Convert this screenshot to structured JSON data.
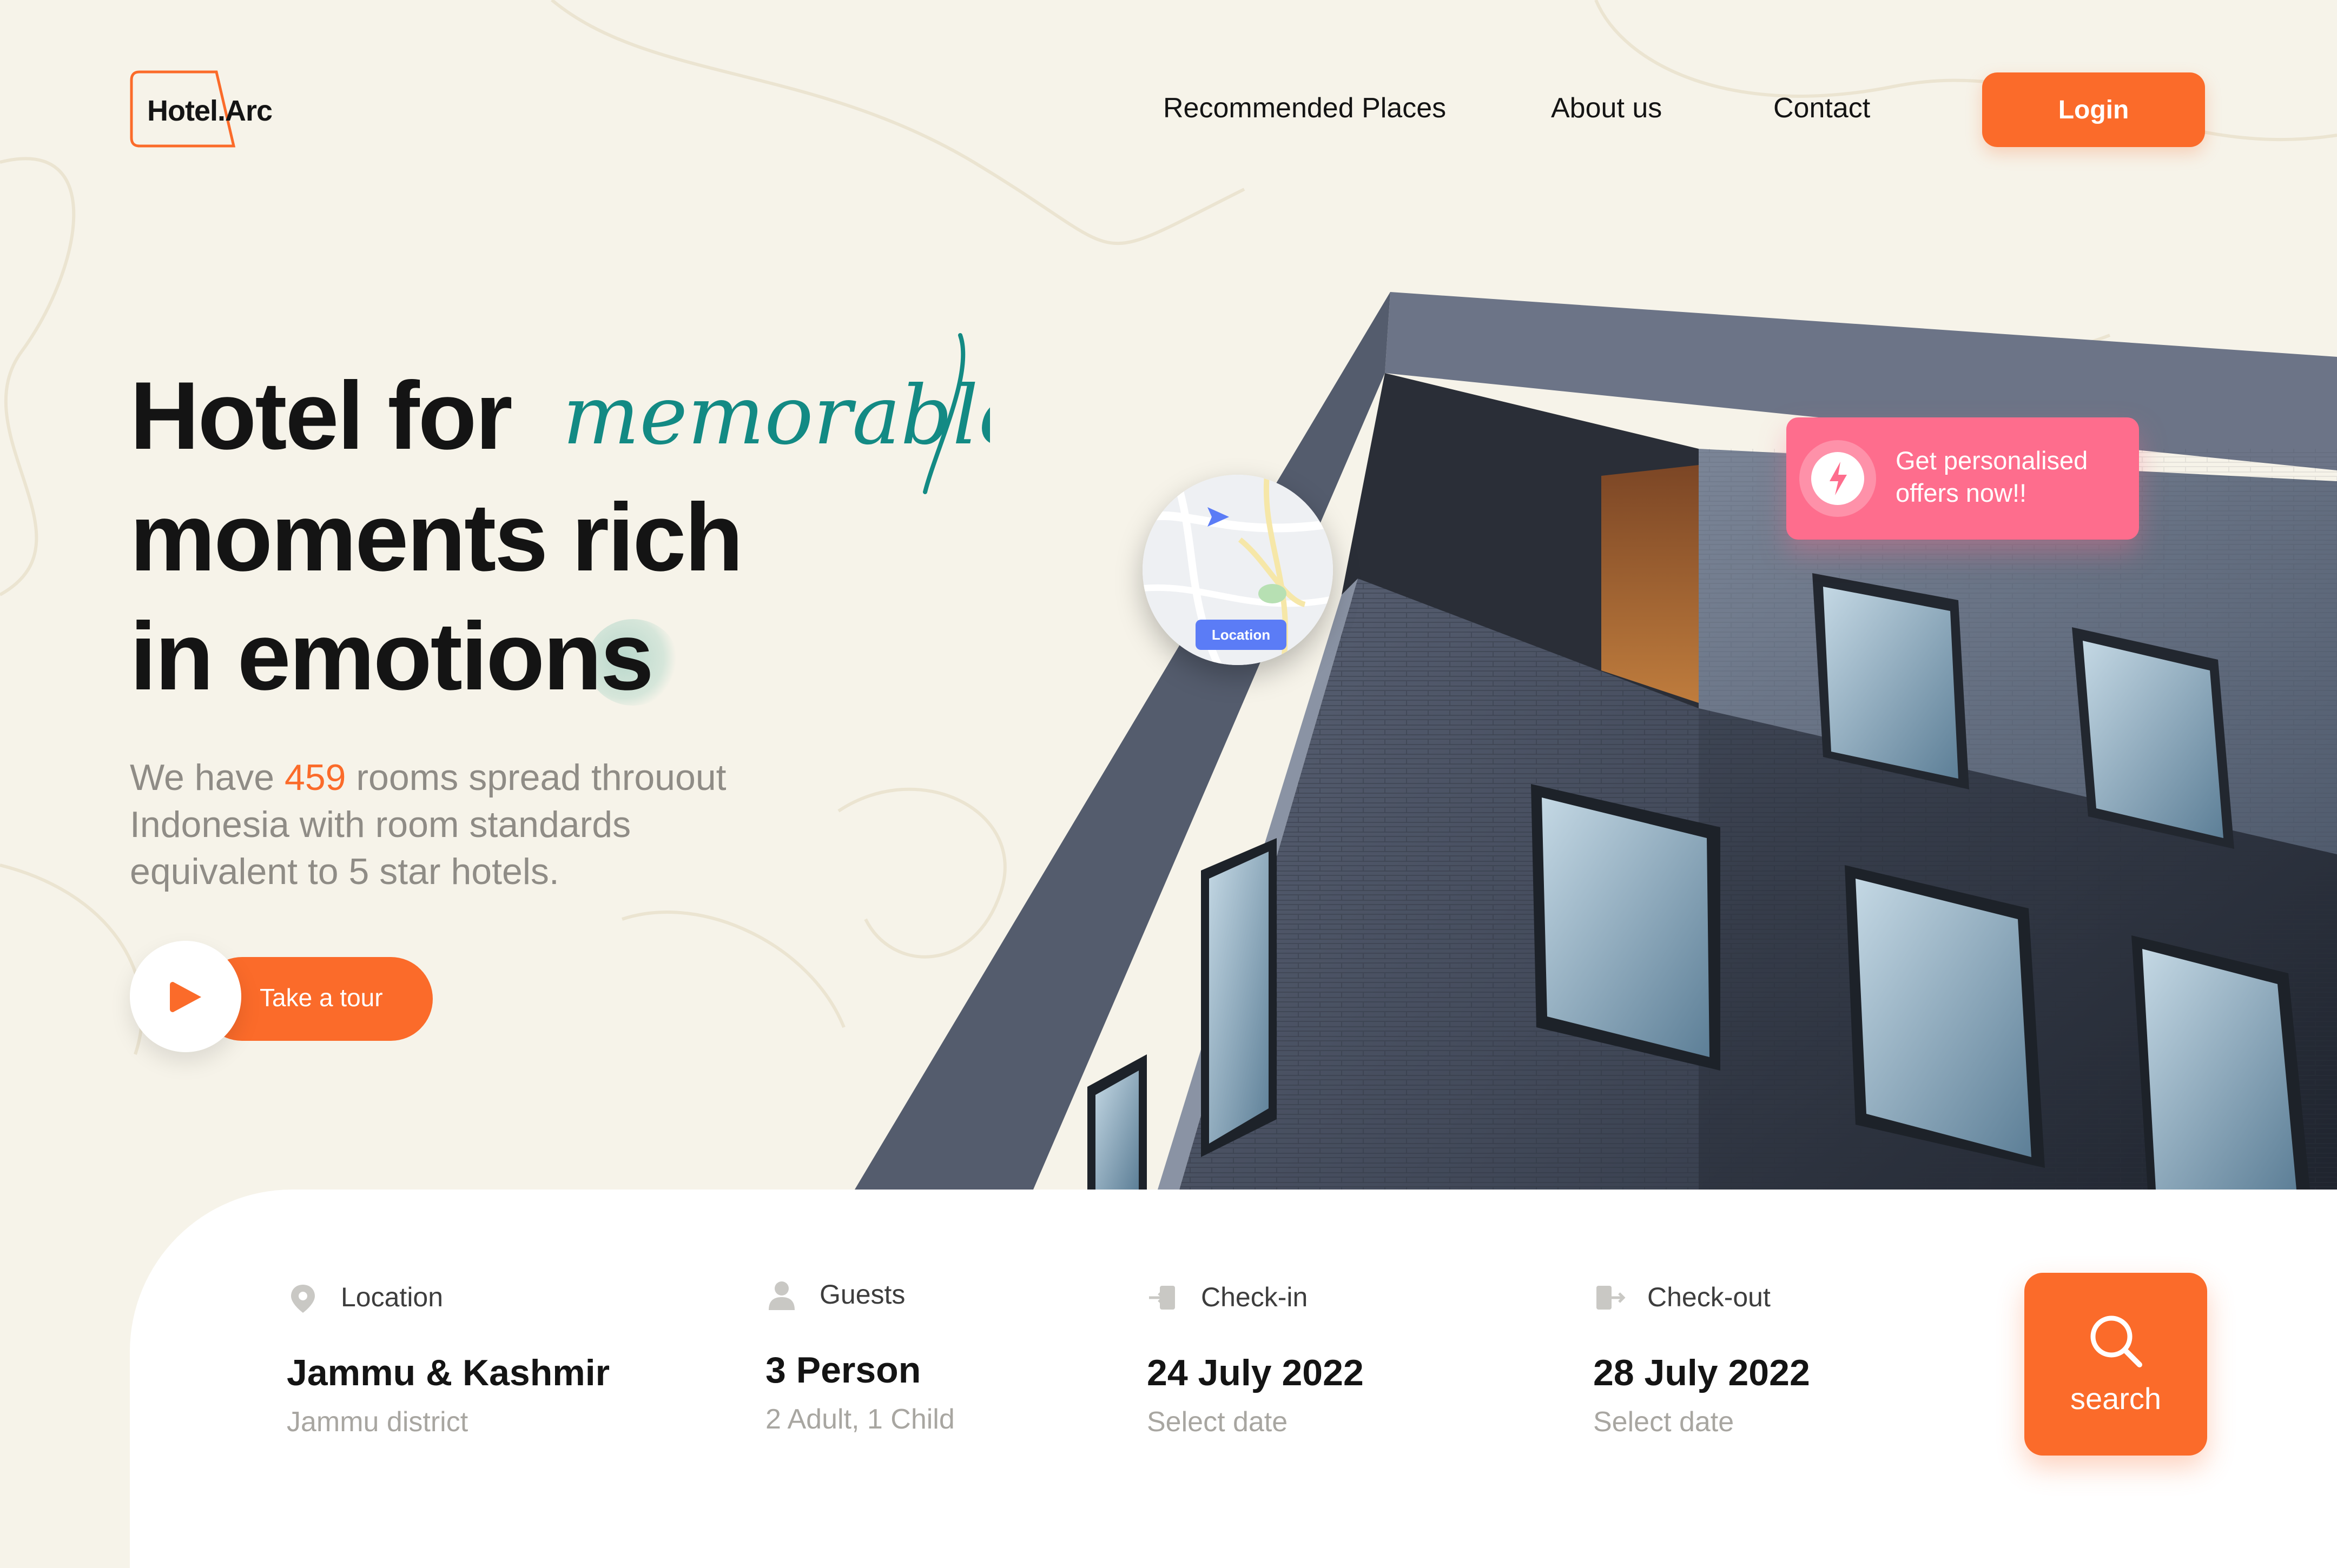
{
  "brand": {
    "name": "Hotel.Arc",
    "accent": "#fb6b2a",
    "pink": "#fe6d8d",
    "teal": "#138a84"
  },
  "nav": {
    "links": [
      "Recommended Places",
      "About us",
      "Contact"
    ],
    "login_label": "Login"
  },
  "hero": {
    "line1": "Hotel for",
    "script_word": "memorable",
    "line2": "moments rich",
    "line3": "in emotions",
    "sub_prefix": "We have ",
    "room_count": "459",
    "sub_suffix": " rooms spread throuout Indonesia with room standards equivalent to 5 star hotels.",
    "tour_label": "Take a tour"
  },
  "map_card": {
    "label": "Location",
    "icon": "map-icon"
  },
  "offer_card": {
    "icon": "lightning-icon",
    "text": "Get personalised offers now!!"
  },
  "booking": {
    "location": {
      "icon": "location-pin-icon",
      "label": "Location",
      "value": "Jammu & Kashmir",
      "sub": "Jammu district"
    },
    "guests": {
      "icon": "person-icon",
      "label": "Guests",
      "value": "3 Person",
      "sub": "2 Adult, 1 Child"
    },
    "checkin": {
      "icon": "check-in-icon",
      "label": "Check-in",
      "value": "24 July 2022",
      "sub": "Select date"
    },
    "checkout": {
      "icon": "check-out-icon",
      "label": "Check-out",
      "value": "28 July 2022",
      "sub": "Select date"
    },
    "search_label": "search"
  }
}
